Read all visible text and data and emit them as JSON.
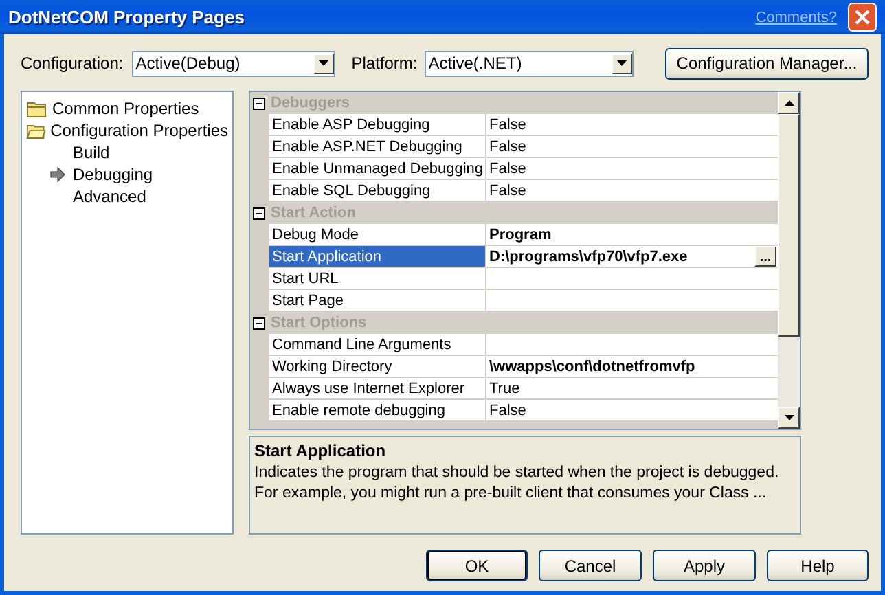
{
  "window": {
    "title": "DotNetCOM Property Pages",
    "comments_link": "Comments?"
  },
  "configuration": {
    "label": "Configuration:",
    "value": "Active(Debug)"
  },
  "platform": {
    "label": "Platform:",
    "value": "Active(.NET)"
  },
  "config_manager_button": "Configuration Manager...",
  "tree": {
    "items": [
      {
        "label": "Common Properties",
        "kind": "folder",
        "expanded": false,
        "selected": false
      },
      {
        "label": "Configuration Properties",
        "kind": "folder",
        "expanded": true,
        "selected": false,
        "children": [
          {
            "label": "Build",
            "selected": false
          },
          {
            "label": "Debugging",
            "selected": true
          },
          {
            "label": "Advanced",
            "selected": false
          }
        ]
      }
    ]
  },
  "properties": {
    "sections": [
      {
        "title": "Debuggers",
        "expanded": true,
        "rows": [
          {
            "name": "Enable ASP Debugging",
            "value": "False",
            "modified": false,
            "selected": false
          },
          {
            "name": "Enable ASP.NET Debugging",
            "value": "False",
            "modified": false,
            "selected": false
          },
          {
            "name": "Enable Unmanaged Debugging",
            "value": "False",
            "modified": false,
            "selected": false
          },
          {
            "name": "Enable SQL Debugging",
            "value": "False",
            "modified": false,
            "selected": false
          }
        ]
      },
      {
        "title": "Start Action",
        "expanded": true,
        "rows": [
          {
            "name": "Debug Mode",
            "value": "Program",
            "modified": true,
            "selected": false
          },
          {
            "name": "Start Application",
            "value": "D:\\programs\\vfp70\\vfp7.exe",
            "modified": true,
            "selected": true,
            "browse_button": "..."
          },
          {
            "name": "Start URL",
            "selected": false
          },
          {
            "name": "Start Page",
            "selected": false
          }
        ]
      },
      {
        "title": "Start Options",
        "expanded": true,
        "rows": [
          {
            "name": "Command Line Arguments",
            "selected": false
          },
          {
            "name": "Working Directory",
            "value": "\\wwapps\\conf\\dotnetfromvfp",
            "modified": true,
            "selected": false
          },
          {
            "name": "Always use Internet Explorer",
            "value": "True",
            "modified": false,
            "selected": false
          },
          {
            "name": "Enable remote debugging",
            "value": "False",
            "modified": false,
            "selected": false
          }
        ]
      }
    ]
  },
  "description": {
    "title": "Start Application",
    "text": "Indicates the program that should be started when the project is debugged. For example, you might run a pre-built client that consumes your Class ..."
  },
  "buttons": [
    {
      "label": "OK",
      "default": true
    },
    {
      "label": "Cancel",
      "default": false
    },
    {
      "label": "Apply",
      "default": false
    },
    {
      "label": "Help",
      "default": false
    }
  ]
}
